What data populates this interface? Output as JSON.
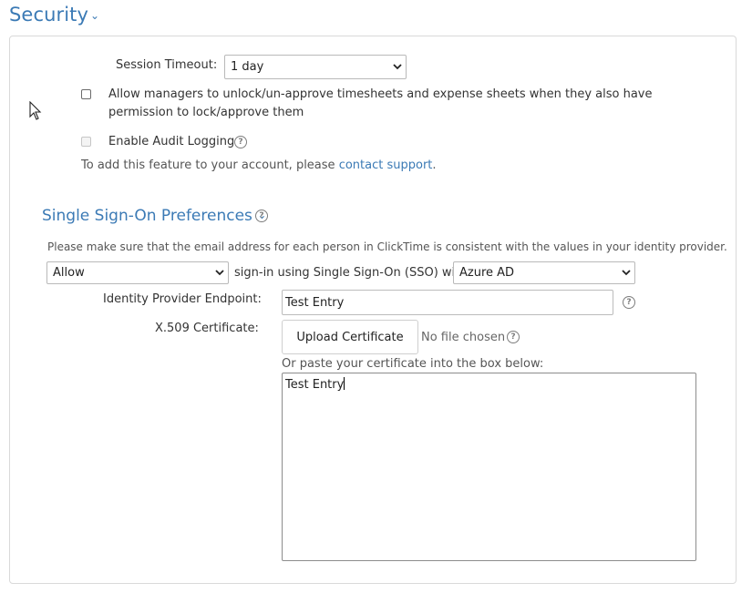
{
  "page_title": "Security",
  "session_timeout": {
    "label": "Session Timeout:",
    "value": "1 day"
  },
  "allow_managers": {
    "checked": false,
    "line1": "Allow managers to unlock/un-approve timesheets and expense sheets when they also have",
    "line2": "permission to lock/approve them"
  },
  "audit_logging": {
    "checked": false,
    "disabled": true,
    "label": "Enable Audit Logging",
    "note_prefix": "To add this feature to your account, please ",
    "note_link": "contact support",
    "note_suffix": "."
  },
  "sso": {
    "title": "Single Sign-On Preferences",
    "description": "Please make sure that the email address for each person in ClickTime is consistent with the values in your identity provider.",
    "allow_value": "Allow",
    "middle_text": "sign-in using Single Sign-On (SSO) with",
    "provider_value": "Azure AD",
    "endpoint_label": "Identity Provider Endpoint:",
    "endpoint_value": "Test Entry",
    "cert_label": "X.509 Certificate:",
    "upload_label": "Upload Certificate",
    "file_status": "No file chosen",
    "paste_hint": "Or paste your certificate into the box below:",
    "cert_text": "Test Entry"
  },
  "icons": {
    "help": "question-circle-icon",
    "dropdown": "chevron-down-icon",
    "cursor": "mouse-pointer-icon"
  },
  "colors": {
    "accent": "#3b7ab5",
    "border": "#d9d9d9"
  }
}
